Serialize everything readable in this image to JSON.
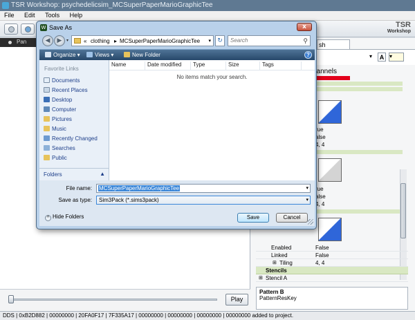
{
  "app": {
    "title": "TSR Workshop: psychedelicsim_MCSuperPaperMarioGraphicTee",
    "menu": [
      "File",
      "Edit",
      "Tools",
      "Help"
    ],
    "logo_top": "TSR",
    "logo_bottom": "Workshop",
    "left_pane_bar": "Pan",
    "play_label": "Play",
    "status": "DDS | 0xB2D882 | 00000000 | 20FA0F17 | 7F335A17 | 00000000 | 00000000 | 00000000 | 00000000 added to project."
  },
  "right_pane": {
    "tab_label": "sh",
    "channels_label": "hannels",
    "values_block1": [
      "rue",
      "alse",
      "4, 4"
    ],
    "values_block2": [
      "rue",
      "alse",
      "4, 4"
    ],
    "properties": [
      {
        "key": "Enabled",
        "value": "False"
      },
      {
        "key": "Linked",
        "value": "False"
      },
      {
        "key": "Tiling",
        "value": "4, 4",
        "expandable": true
      }
    ],
    "category": "Stencils",
    "stencil_item": "Stencil A",
    "description_title": "Pattern B",
    "description_text": "PatternResKey"
  },
  "dialog": {
    "title": "Save As",
    "close_glyph": "x",
    "address": {
      "prefix": "«",
      "crumbs": [
        "clothing",
        "MCSuperPaperMarioGraphicTee"
      ]
    },
    "search_placeholder": "Search",
    "commands": {
      "organize": "Organize ▾",
      "views": "Views ▾",
      "new_folder": "New Folder"
    },
    "nav": {
      "header": "Favorite Links",
      "items": [
        "Documents",
        "Recent Places",
        "Desktop",
        "Computer",
        "Pictures",
        "Music",
        "Recently Changed",
        "Searches",
        "Public"
      ],
      "folders_label": "Folders"
    },
    "columns": [
      "Name",
      "Date modified",
      "Type",
      "Size",
      "Tags"
    ],
    "empty_message": "No items match your search.",
    "file_name_label": "File name:",
    "file_name_value": "MCSuperPaperMarioGraphicTee",
    "save_type_label": "Save as type:",
    "save_type_value": "Sim3Pack (*.sims3pack)",
    "hide_folders_label": "Hide Folders",
    "save_button": "Save",
    "cancel_button": "Cancel"
  },
  "colors": {
    "accent_blue": "#2f66d9",
    "red_channel": "#e3001b",
    "category_green": "#d9e8c3"
  }
}
